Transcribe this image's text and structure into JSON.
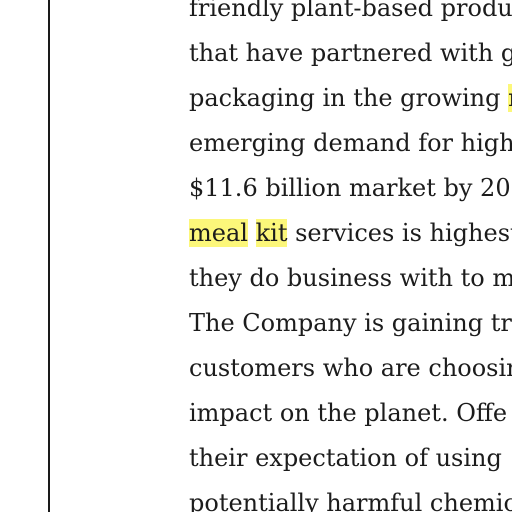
{
  "document": {
    "highlight_color": "#fcf77a",
    "lines": [
      {
        "text": "friendly plant-based produ"
      },
      {
        "text": "that have partnered with g"
      },
      {
        "before": "packaging in the growing ",
        "highlight": "n",
        "after": ""
      },
      {
        "text": "emerging demand for high"
      },
      {
        "text": "$11.6 billion market by 20"
      },
      {
        "highlight": "meal",
        "between": " ",
        "highlight2": "kit",
        "after": " services is highest"
      },
      {
        "text": "they do business with to m"
      },
      {
        "text": "The Company is gaining tr"
      },
      {
        "text": "customers who are choosin"
      },
      {
        "text": "impact on the planet. Offe"
      },
      {
        "text": "their expectation of using"
      },
      {
        "text": "potentially harmful chemic"
      }
    ]
  }
}
